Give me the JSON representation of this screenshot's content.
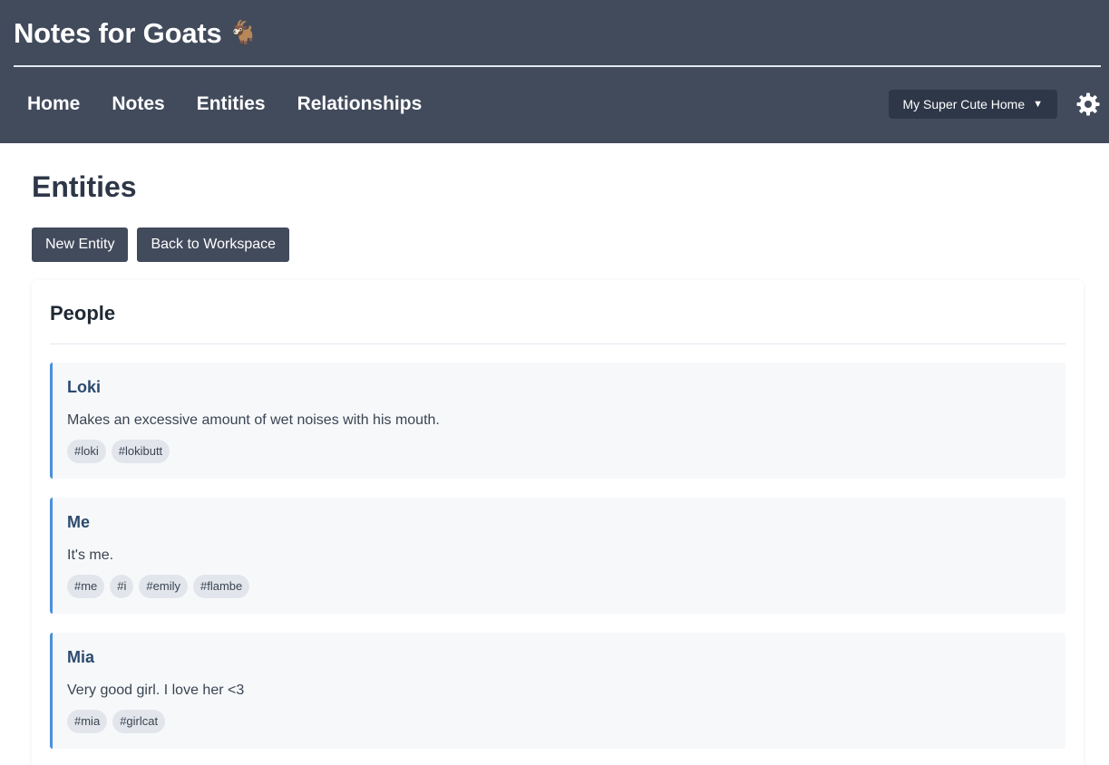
{
  "app": {
    "title": "Notes for Goats",
    "emoji": "🐐"
  },
  "nav": {
    "links": [
      {
        "label": "Home"
      },
      {
        "label": "Notes"
      },
      {
        "label": "Entities"
      },
      {
        "label": "Relationships"
      }
    ],
    "workspace": {
      "selected": "My Super Cute Home",
      "caret": "▼"
    },
    "settings_icon": "gear-icon"
  },
  "page": {
    "title": "Entities",
    "buttons": {
      "new_entity": "New Entity",
      "back": "Back to Workspace"
    }
  },
  "sections": [
    {
      "title": "People",
      "entities": [
        {
          "name": "Loki",
          "description": "Makes an excessive amount of wet noises with his mouth.",
          "tags": [
            "#loki",
            "#lokibutt"
          ]
        },
        {
          "name": "Me",
          "description": "It's me.",
          "tags": [
            "#me",
            "#i",
            "#emily",
            "#flambe"
          ]
        },
        {
          "name": "Mia",
          "description": "Very good girl. I love her <3",
          "tags": [
            "#mia",
            "#girlcat"
          ]
        }
      ]
    }
  ],
  "colors": {
    "header_bg": "#424b5c",
    "accent": "#4a90d9",
    "entity_name": "#2c4a6e"
  }
}
